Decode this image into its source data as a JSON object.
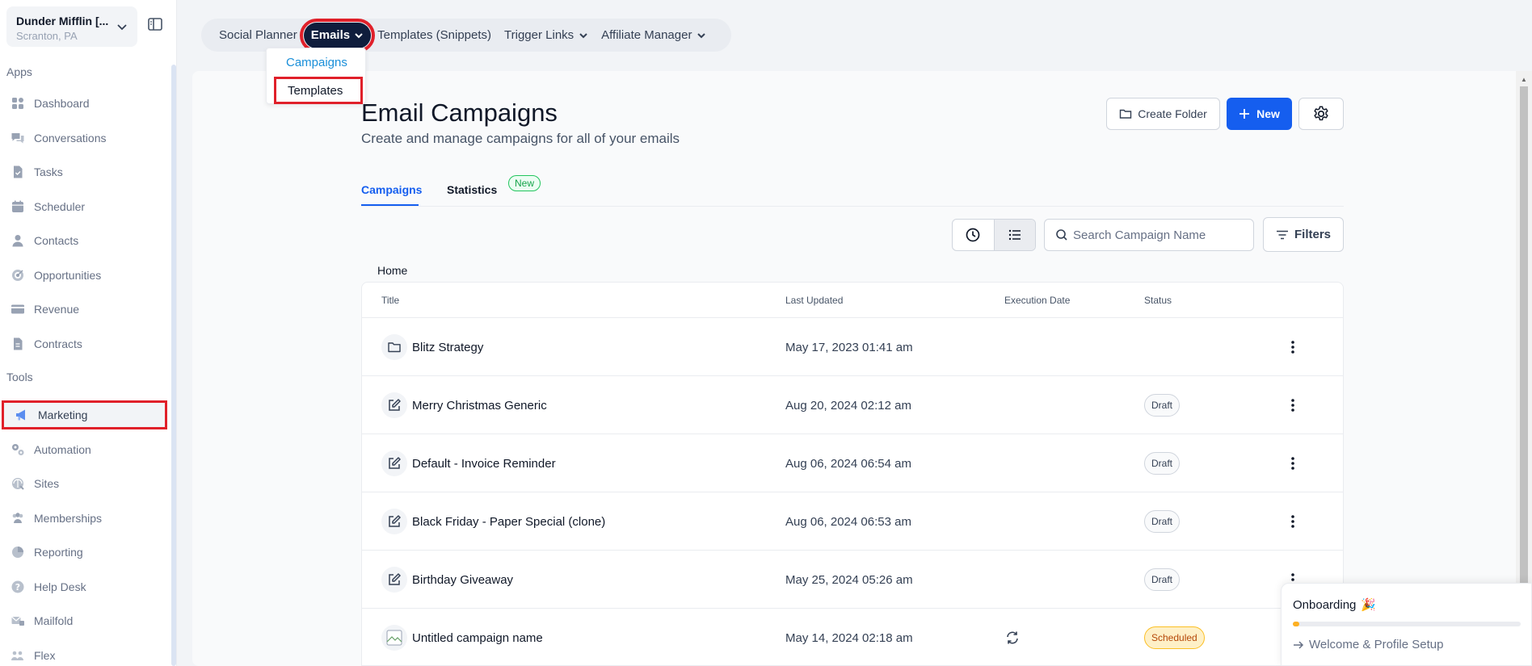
{
  "company": {
    "name": "Dunder Mifflin [...",
    "location": "Scranton, PA"
  },
  "sidebar": {
    "apps_title": "Apps",
    "tools_title": "Tools",
    "apps": [
      {
        "label": "Dashboard",
        "icon": "dashboard-icon"
      },
      {
        "label": "Conversations",
        "icon": "chat-icon"
      },
      {
        "label": "Tasks",
        "icon": "tasks-icon"
      },
      {
        "label": "Scheduler",
        "icon": "calendar-icon"
      },
      {
        "label": "Contacts",
        "icon": "person-icon"
      },
      {
        "label": "Opportunities",
        "icon": "target-icon"
      },
      {
        "label": "Revenue",
        "icon": "card-icon"
      },
      {
        "label": "Contracts",
        "icon": "document-icon"
      }
    ],
    "tools": [
      {
        "label": "Marketing",
        "icon": "megaphone-icon",
        "active": true
      },
      {
        "label": "Automation",
        "icon": "gears-icon"
      },
      {
        "label": "Sites",
        "icon": "globe-icon"
      },
      {
        "label": "Memberships",
        "icon": "users-icon"
      },
      {
        "label": "Reporting",
        "icon": "pie-chart-icon"
      },
      {
        "label": "Help Desk",
        "icon": "help-icon"
      },
      {
        "label": "Mailfold",
        "icon": "mailfold-icon"
      },
      {
        "label": "Flex",
        "icon": "flex-icon"
      }
    ]
  },
  "topnav": {
    "items": [
      "Social Planner",
      "Emails",
      "Templates (Snippets)",
      "Trigger Links",
      "Affiliate Manager"
    ],
    "active": "Emails"
  },
  "emails_dropdown": {
    "items": [
      "Campaigns",
      "Templates"
    ]
  },
  "page": {
    "title": "Email Campaigns",
    "subtitle": "Create and manage campaigns for all of your emails",
    "create_folder": "Create Folder",
    "new": "New",
    "tabs": [
      "Campaigns",
      "Statistics"
    ],
    "new_badge": "New",
    "search_placeholder": "Search Campaign Name",
    "filters": "Filters",
    "breadcrumb": "Home"
  },
  "table": {
    "columns": [
      "Title",
      "Last Updated",
      "Execution Date",
      "Status"
    ],
    "rows": [
      {
        "icon": "folder-icon",
        "title": "Blitz Strategy",
        "updated": "May 17, 2023 01:41 am",
        "status": ""
      },
      {
        "icon": "edit-icon",
        "title": "Merry Christmas Generic",
        "updated": "Aug 20, 2024 02:12 am",
        "status": "Draft"
      },
      {
        "icon": "edit-icon",
        "title": "Default - Invoice Reminder",
        "updated": "Aug 06, 2024 06:54 am",
        "status": "Draft"
      },
      {
        "icon": "edit-icon",
        "title": "Black Friday - Paper Special (clone)",
        "updated": "Aug 06, 2024 06:53 am",
        "status": "Draft"
      },
      {
        "icon": "edit-icon",
        "title": "Birthday Giveaway",
        "updated": "May 25, 2024 05:26 am",
        "status": "Draft"
      },
      {
        "icon": "broken-image-icon",
        "title": "Untitled campaign name",
        "updated": "May 14, 2024 02:18 am",
        "status": "Scheduled",
        "exec_icon": "recurring-icon"
      }
    ]
  },
  "onboarding": {
    "title": "Onboarding",
    "step": "Welcome & Profile Setup",
    "progress": 0.03
  },
  "colors": {
    "accent": "#155eef",
    "highlight": "#e0202a",
    "nav_dark": "#0f1d3c"
  }
}
